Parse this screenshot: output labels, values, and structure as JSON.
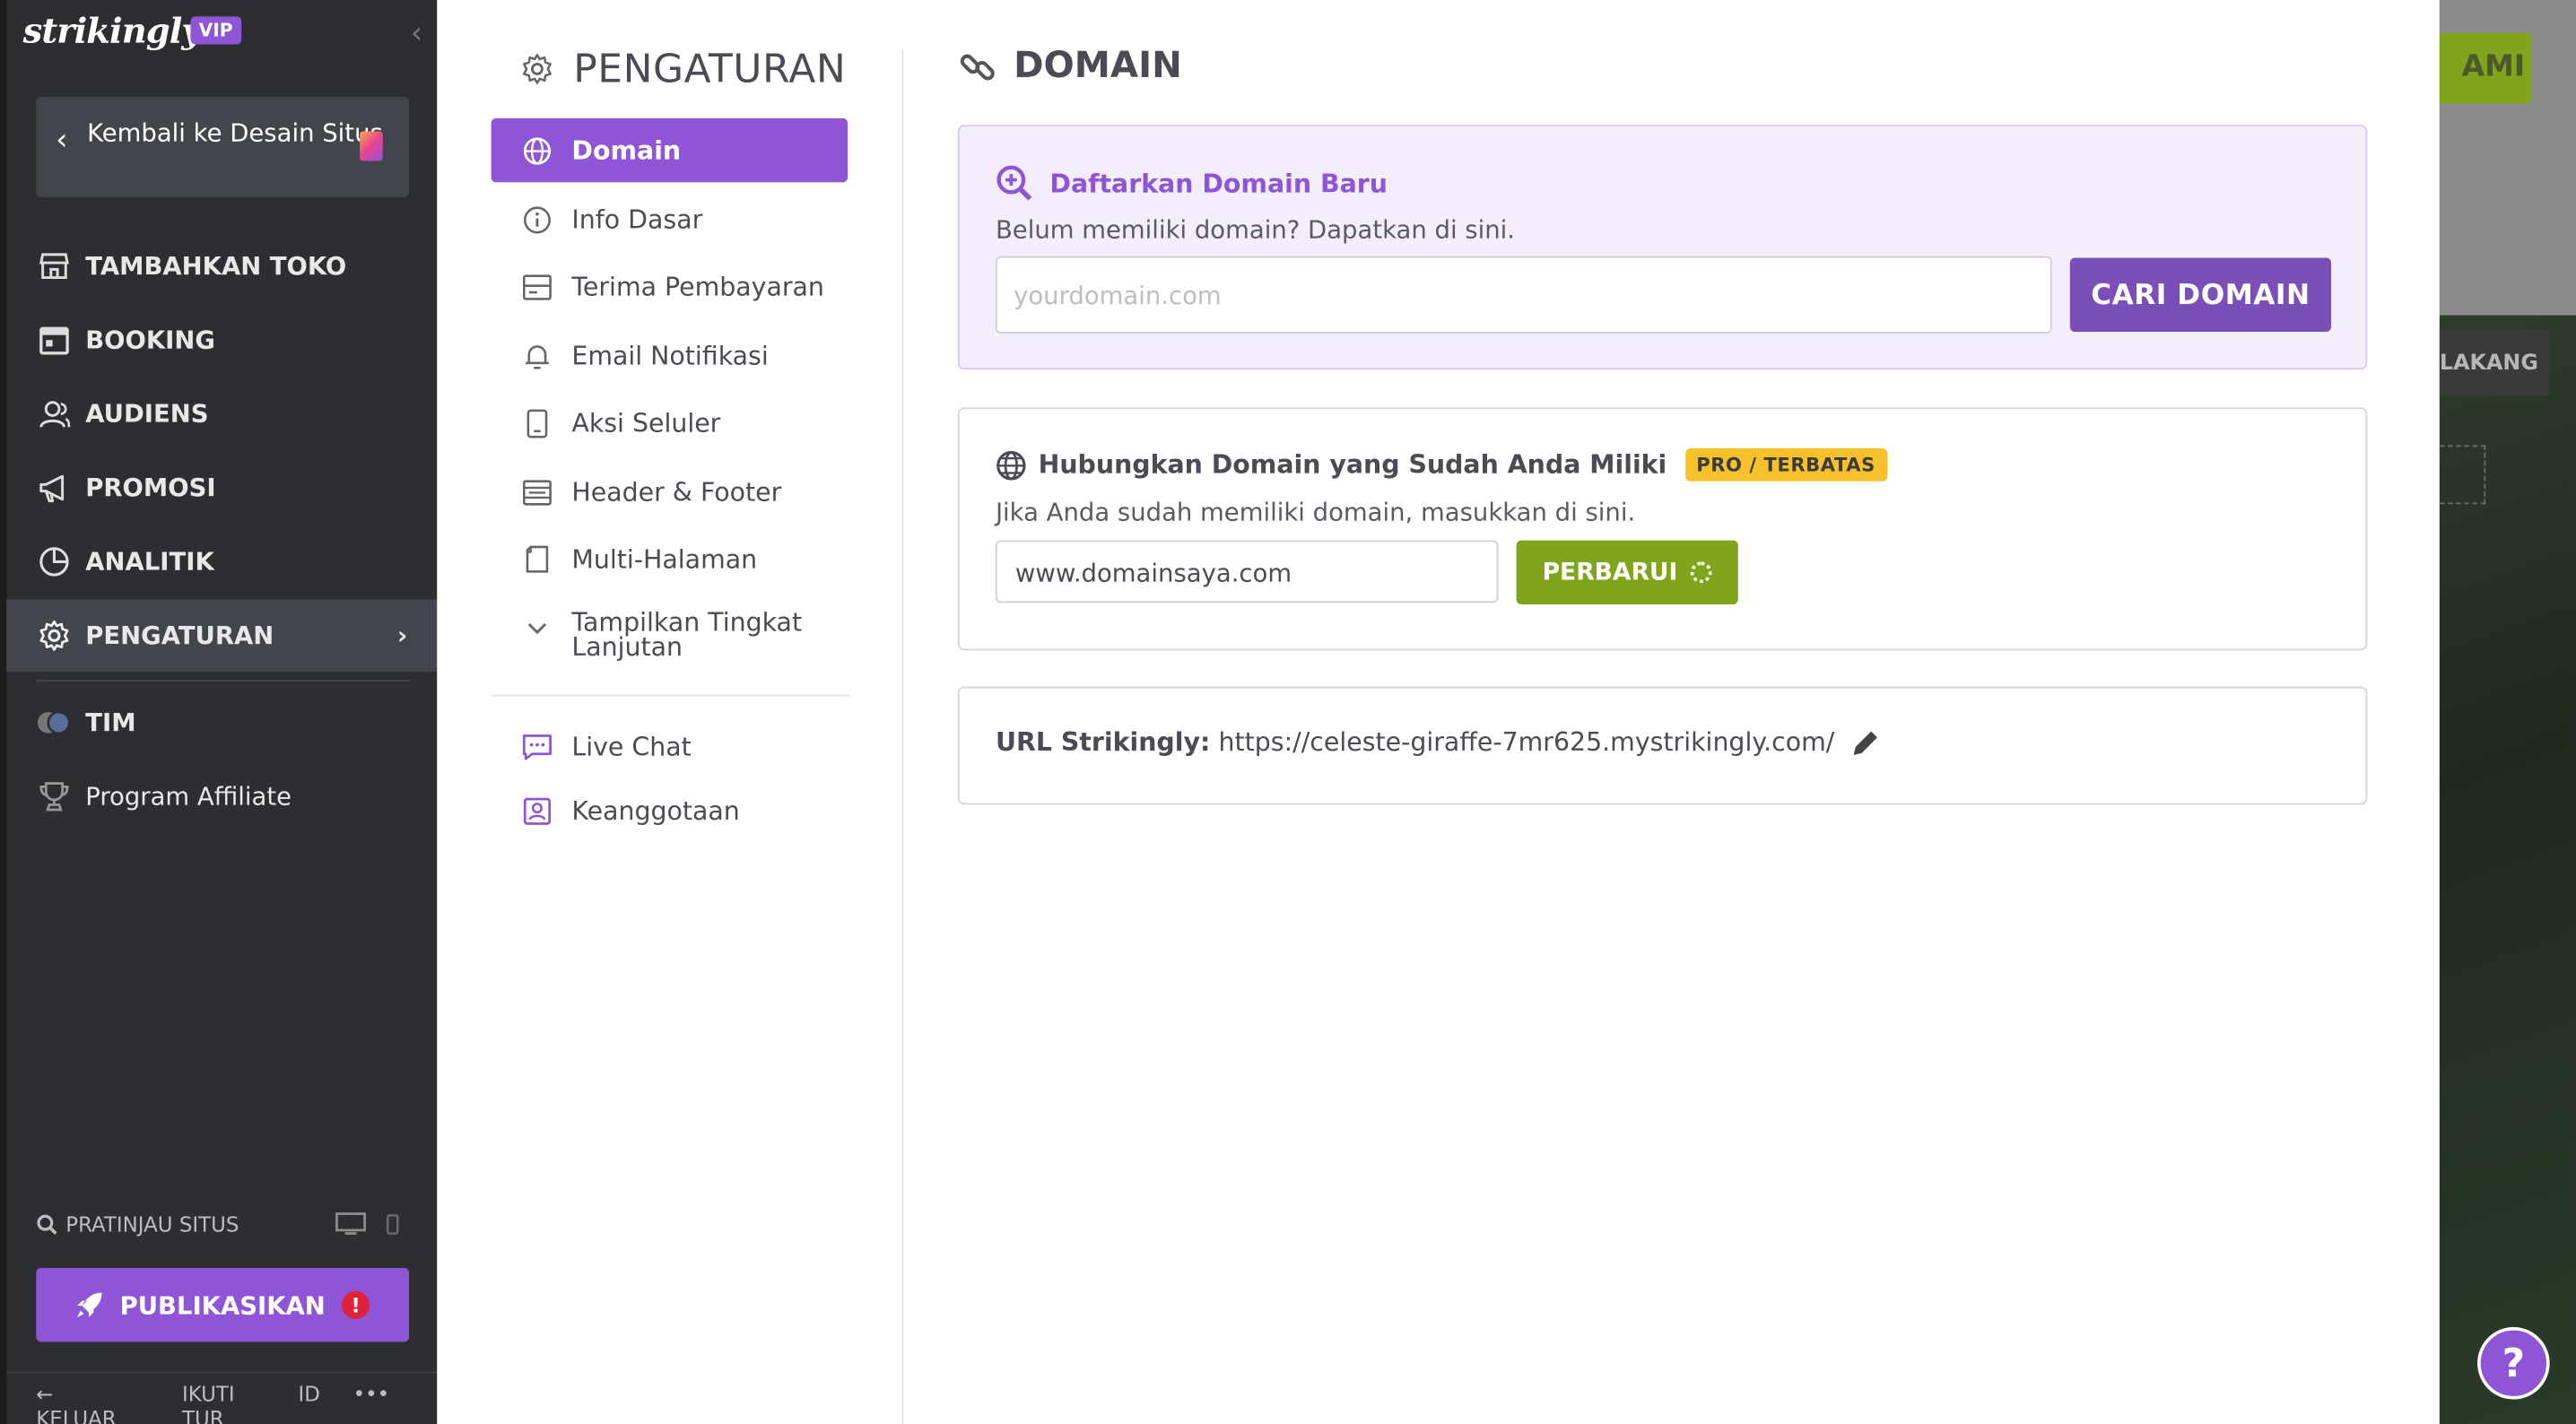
{
  "brand": {
    "logo": "strikingly",
    "vip": "VIP"
  },
  "sidebar": {
    "back_label": "Kembali ke Desain Situs",
    "items": [
      {
        "label": "TAMBAHKAN TOKO",
        "icon": "store-icon"
      },
      {
        "label": "BOOKING",
        "icon": "calendar-icon"
      },
      {
        "label": "AUDIENS",
        "icon": "users-icon"
      },
      {
        "label": "PROMOSI",
        "icon": "megaphone-icon"
      },
      {
        "label": "ANALITIK",
        "icon": "pie-chart-icon"
      },
      {
        "label": "PENGATURAN",
        "icon": "gear-icon",
        "active": true
      },
      {
        "label": "TIM",
        "icon": "team-avatar-icon"
      },
      {
        "label": "Program Affiliate",
        "icon": "trophy-icon"
      }
    ],
    "preview_label": "PRATINJAU SITUS",
    "publish_label": "PUBLIKASIKAN",
    "publish_warning": "!",
    "footer": {
      "logout": "KELUAR",
      "tour": "IKUTI TUR",
      "lang": "ID",
      "more": "•••"
    }
  },
  "settings": {
    "title": "PENGATURAN",
    "menu": [
      {
        "label": "Domain",
        "icon": "globe-icon",
        "active": true
      },
      {
        "label": "Info Dasar",
        "icon": "info-icon"
      },
      {
        "label": "Terima Pembayaran",
        "icon": "card-icon"
      },
      {
        "label": "Email Notifikasi",
        "icon": "bell-icon"
      },
      {
        "label": "Aksi Seluler",
        "icon": "mobile-icon"
      },
      {
        "label": "Header & Footer",
        "icon": "layout-icon"
      },
      {
        "label": "Multi-Halaman",
        "icon": "pages-icon"
      },
      {
        "label": "Tampilkan Tingkat Lanjutan",
        "icon": "chevron-down-icon"
      },
      {
        "label": "Live Chat",
        "icon": "chat-icon"
      },
      {
        "label": "Keanggotaan",
        "icon": "member-icon"
      }
    ]
  },
  "domain": {
    "title": "DOMAIN",
    "register": {
      "heading": "Daftarkan Domain Baru",
      "subtext": "Belum memiliki domain? Dapatkan di sini.",
      "placeholder": "yourdomain.com",
      "button": "CARI DOMAIN"
    },
    "connect": {
      "heading": "Hubungkan Domain yang Sudah Anda Miliki",
      "badge": "PRO / TERBATAS",
      "subtext": "Jika Anda sudah memiliki domain, masukkan di sini.",
      "value": "www.domainsaya.com",
      "button": "PERBARUI"
    },
    "url": {
      "label": "URL Strikingly:",
      "value": "https://celeste-giraffe-7mr625.mystrikingly.com/"
    }
  },
  "background": {
    "cta_fragment": "AMI",
    "pill_fragment": "LAKANG",
    "help": "?"
  },
  "colors": {
    "accent": "#8e55d6",
    "button_purple": "#7b4fb8",
    "green": "#7fa51c",
    "badge": "#f6c12d",
    "sidebar": "#2d2e32"
  }
}
